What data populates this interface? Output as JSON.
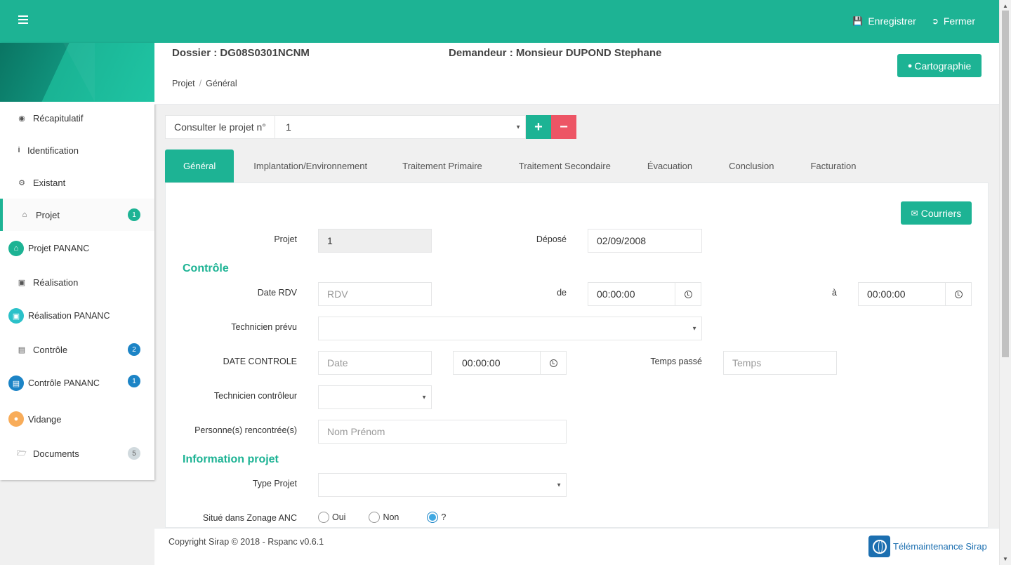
{
  "topbar": {
    "save_label": "Enregistrer",
    "close_label": "Fermer",
    "accent_color": "#1db394"
  },
  "sidebar": {
    "items": [
      {
        "label": "Récapitulatif",
        "icon": "eye-icon"
      },
      {
        "label": "Identification",
        "icon": "info-icon"
      },
      {
        "label": "Existant",
        "icon": "gears-icon"
      },
      {
        "label": "Projet",
        "icon": "home-icon",
        "badge": "1",
        "active": true
      },
      {
        "label": "Projet PANANC",
        "icon": "home-icon"
      },
      {
        "label": "Réalisation",
        "icon": "truck-icon"
      },
      {
        "label": "Réalisation PANANC",
        "icon": "truck-icon"
      },
      {
        "label": "Contrôle",
        "icon": "book-icon",
        "badge": "2"
      },
      {
        "label": "Contrôle PANANC",
        "icon": "book-icon",
        "badge": "1"
      },
      {
        "label": "Vidange",
        "icon": "drop-icon"
      },
      {
        "label": "Documents",
        "icon": "folder-icon",
        "badge": "5"
      }
    ]
  },
  "header": {
    "dossier": "Dossier : DG08S0301NCNM",
    "demandeur": "Demandeur : Monsieur DUPOND  Stephane",
    "breadcrumb": [
      "Projet",
      "Général"
    ],
    "carto_label": "Cartographie"
  },
  "project_selector": {
    "label": "Consulter le projet n°",
    "value": "1"
  },
  "tabs": [
    "Général",
    "Implantation/Environnement",
    "Traitement Primaire",
    "Traitement Secondaire",
    "Évacuation",
    "Conclusion",
    "Facturation"
  ],
  "form": {
    "courriers_label": "Courriers",
    "projet_label": "Projet",
    "projet_value": "1",
    "depose_label": "Déposé",
    "depose_value": "02/09/2008",
    "section_controle": "Contrôle",
    "date_rdv_label": "Date RDV",
    "date_rdv_placeholder": "RDV",
    "de_label": "de",
    "de_value": "00:00:00",
    "a_label": "à",
    "a_value": "00:00:00",
    "tech_prevu_label": "Technicien prévu",
    "date_controle_label": "DATE CONTROLE",
    "date_controle_placeholder": "Date",
    "heure_controle_value": "00:00:00",
    "temps_passe_label": "Temps passé",
    "temps_passe_placeholder": "Temps",
    "tech_controleur_label": "Technicien contrôleur",
    "personnes_label": "Personne(s) rencontrée(s)",
    "personnes_placeholder": "Nom Prénom",
    "section_info": "Information projet",
    "type_projet_label": "Type Projet",
    "zonage_label": "Situé dans Zonage ANC",
    "zonage_options": [
      "Oui",
      "Non",
      "?"
    ],
    "zonage_selected": "?"
  },
  "footer": {
    "copyright": "Copyright Sirap © 2018 - Rspanc v0.6.1",
    "brand": "Télémaintenance Sirap"
  }
}
